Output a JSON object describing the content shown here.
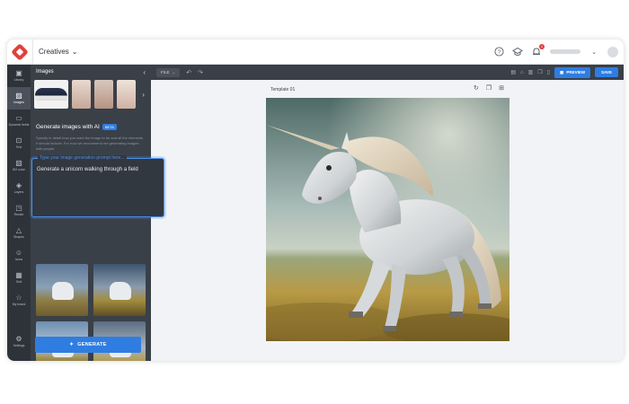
{
  "header": {
    "project_name": "Creatives",
    "notification_count": "1"
  },
  "rail": {
    "items": [
      {
        "label": "Library",
        "icon": "library-icon"
      },
      {
        "label": "Images",
        "icon": "image-icon",
        "active": true
      },
      {
        "label": "Dynamic fields",
        "icon": "dynamic-fields-icon"
      },
      {
        "label": "Text",
        "icon": "text-icon"
      },
      {
        "label": "BG color",
        "icon": "bg-color-icon"
      },
      {
        "label": "Layers",
        "icon": "layers-icon"
      },
      {
        "label": "Resize",
        "icon": "resize-icon"
      },
      {
        "label": "Shapes",
        "icon": "shapes-icon"
      },
      {
        "label": "Icons",
        "icon": "icons-icon"
      },
      {
        "label": "Grid",
        "icon": "grid-icon"
      },
      {
        "label": "My brand",
        "icon": "star-icon"
      },
      {
        "label": "Settings",
        "icon": "gear-icon"
      }
    ]
  },
  "panel": {
    "title": "Images",
    "gen_title": "Generate images with AI",
    "beta": "BETA",
    "gen_description": "Specify in detail how you want the image to be and all the elements it should include. For now we recommend not generating images with people.",
    "prompt_placeholder": "Type your image generation prompt here...",
    "prompt_value": "Generate a unicorn walking through a field",
    "generate_label": "GENERATE"
  },
  "toolbar": {
    "file_label": "FILE",
    "preview_label": "PREVIEW",
    "save_label": "SAVE"
  },
  "canvas": {
    "template_label": "Template 01"
  },
  "colors": {
    "accent": "#2f7de1",
    "panel": "#3a4048",
    "rail": "#2e333a",
    "brand": "#e2403a"
  }
}
